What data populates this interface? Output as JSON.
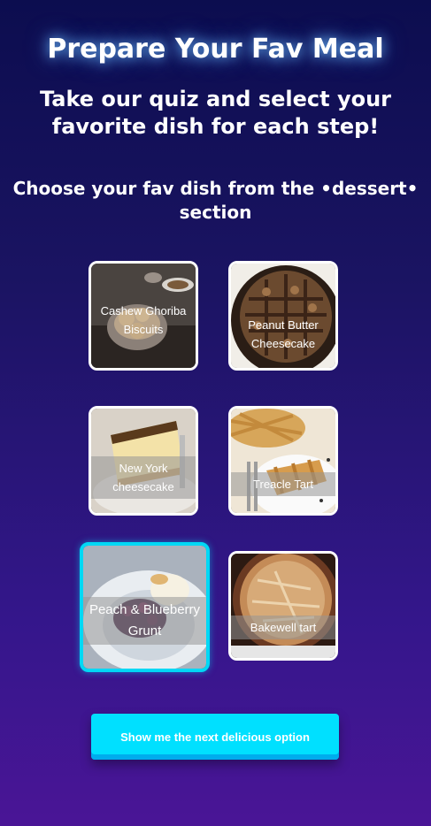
{
  "header": {
    "title": "Prepare Your Fav Meal",
    "subtitle": "Take our quiz and select your favorite dish for each step!",
    "section_prompt": "Choose your fav dish from the •dessert• section"
  },
  "dishes": [
    {
      "name": "Cashew Ghoriba Biscuits",
      "selected": false
    },
    {
      "name": "Peanut Butter Cheesecake",
      "selected": false
    },
    {
      "name": "New York cheesecake",
      "selected": false
    },
    {
      "name": "Treacle Tart",
      "selected": false
    },
    {
      "name": "Peach & Blueberry Grunt",
      "selected": true
    },
    {
      "name": "Bakewell tart",
      "selected": false
    }
  ],
  "next_button": "Show me the next delicious option",
  "colors": {
    "accent": "#00e0ff",
    "selected_border": "#00d8f5"
  }
}
